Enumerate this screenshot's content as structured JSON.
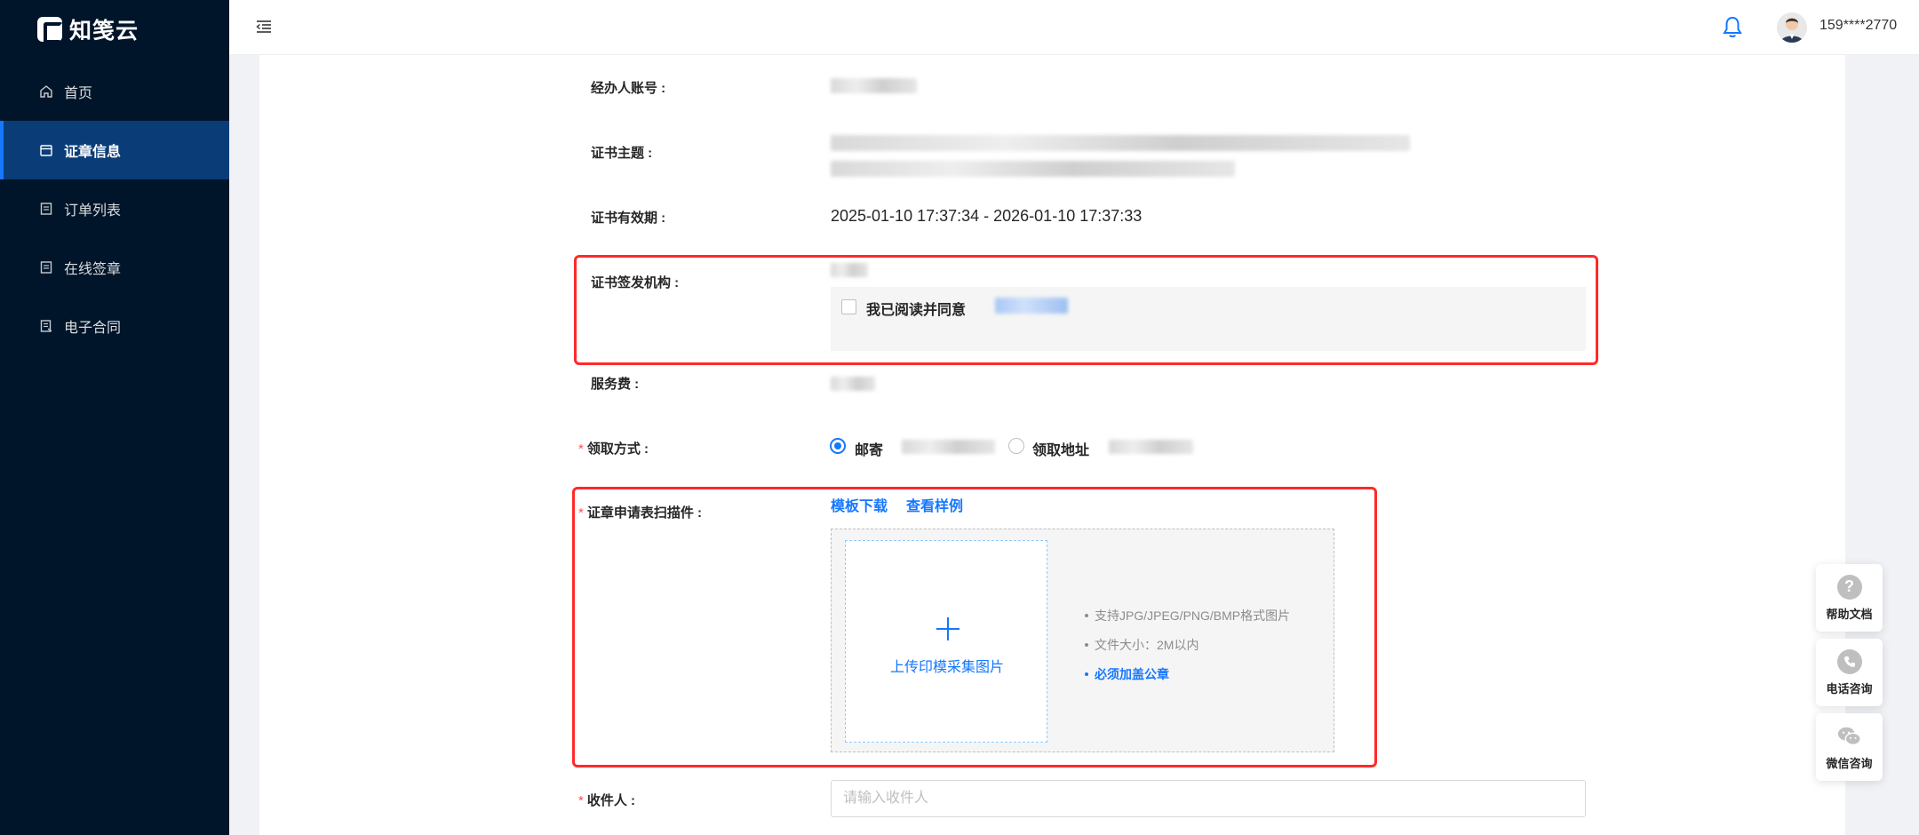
{
  "app": {
    "logo_text": "知笺云"
  },
  "sidebar": {
    "items": [
      {
        "label": "首页",
        "icon": "home-icon"
      },
      {
        "label": "证章信息",
        "icon": "calendar-icon",
        "active": true
      },
      {
        "label": "订单列表",
        "icon": "list-icon"
      },
      {
        "label": "在线签章",
        "icon": "doc-icon"
      },
      {
        "label": "电子合同",
        "icon": "contract-icon"
      }
    ]
  },
  "header": {
    "username": "159****2770"
  },
  "form": {
    "agent_account_label": "经办人账号 :",
    "cert_subject_label": "证书主题 :",
    "cert_validity_label": "证书有效期 :",
    "cert_validity_value": "2025-01-10 17:37:34 - 2026-01-10 17:37:33",
    "cert_issuer_label": "证书签发机构 :",
    "agree_text": "我已阅读并同意",
    "service_fee_label": "服务费 :",
    "pickup_method_label": "领取方式 :",
    "pickup_option_mail": "邮寄",
    "pickup_option_address": "领取地址",
    "scan_label": "证章申请表扫描件 :",
    "template_download": "模板下载",
    "view_sample": "查看样例",
    "upload_text": "上传印模采集图片",
    "tips": [
      "支持JPG/JPEG/PNG/BMP格式图片",
      "文件大小：2M以内",
      "必须加盖公章"
    ],
    "recipient_label": "收件人 :",
    "recipient_placeholder": "请输入收件人"
  },
  "side_tools": [
    {
      "label": "帮助文档",
      "icon": "question-icon"
    },
    {
      "label": "电话咨询",
      "icon": "phone-icon"
    },
    {
      "label": "微信咨询",
      "icon": "wechat-icon"
    }
  ]
}
